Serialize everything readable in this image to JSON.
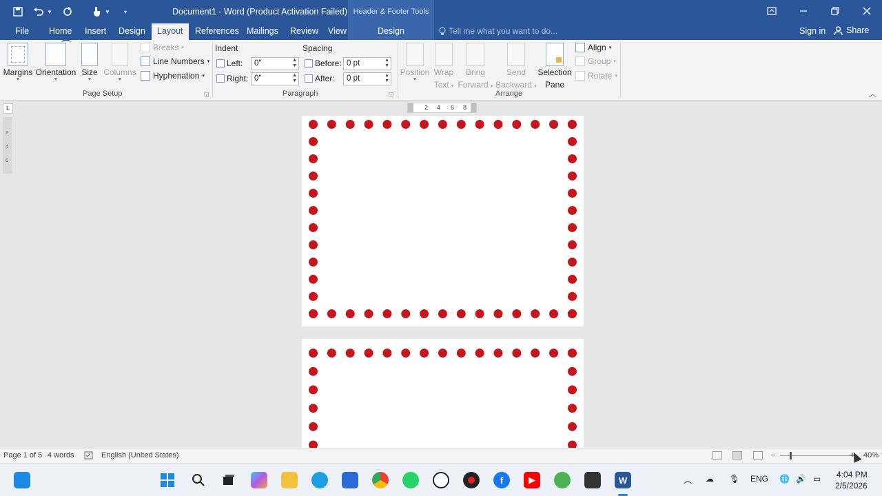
{
  "titlebar": {
    "doc_title": "Document1 - Word (Product Activation Failed)",
    "context_title": "Header & Footer Tools",
    "qat_icons": [
      "save-icon",
      "undo-icon",
      "redo-icon",
      "touch-mode-icon",
      "customize-qat-icon"
    ]
  },
  "tabs": [
    {
      "label": "File"
    },
    {
      "label": "Home"
    },
    {
      "label": "Insert"
    },
    {
      "label": "Design"
    },
    {
      "label": "Layout"
    },
    {
      "label": "References"
    },
    {
      "label": "Mailings"
    },
    {
      "label": "Review"
    },
    {
      "label": "View"
    },
    {
      "label": "Design"
    }
  ],
  "active_tab": "Layout",
  "tellme": "Tell me what you want to do...",
  "signin": "Sign in",
  "share": "Share",
  "ribbon": {
    "page_setup": {
      "margins": "Margins",
      "orientation": "Orientation",
      "size": "Size",
      "columns": "Columns",
      "breaks": "Breaks",
      "line_numbers": "Line Numbers",
      "hyphenation": "Hyphenation",
      "label": "Page Setup"
    },
    "paragraph": {
      "indent_title": "Indent",
      "spacing_title": "Spacing",
      "left_label": "Left:",
      "left_value": "0\"",
      "right_label": "Right:",
      "right_value": "0\"",
      "before_label": "Before:",
      "before_value": "0 pt",
      "after_label": "After:",
      "after_value": "0 pt",
      "label": "Paragraph"
    },
    "arrange": {
      "position": "Position",
      "wrap": "Wrap",
      "wrap2": "Text",
      "bring": "Bring",
      "bring2": "Forward",
      "send": "Send",
      "send2": "Backward",
      "selection": "Selection",
      "selection2": "Pane",
      "align": "Align",
      "group": "Group",
      "rotate": "Rotate",
      "label": "Arrange"
    }
  },
  "ruler": {
    "vertical": [
      "2",
      "4",
      "6"
    ],
    "horizontal": [
      "2",
      "4",
      "6",
      "8"
    ],
    "tab_selector": "L"
  },
  "statusbar": {
    "page": "Page 1 of 5",
    "words": "4 words",
    "language": "English (United States)",
    "zoom": "40%"
  },
  "taskbar": {
    "apps": [
      "windows-start-icon",
      "search-icon",
      "task-view-icon",
      "copilot-icon",
      "file-explorer-icon",
      "edge-icon",
      "store-icon",
      "chrome-icon",
      "whatsapp-icon",
      "chatgpt-icon",
      "recorder-icon",
      "facebook-icon",
      "youtube-icon",
      "app-green-icon",
      "camera-icon",
      "word-icon"
    ],
    "lang": "ENG",
    "time": "4:04 PM",
    "date": "2/5/2026"
  }
}
